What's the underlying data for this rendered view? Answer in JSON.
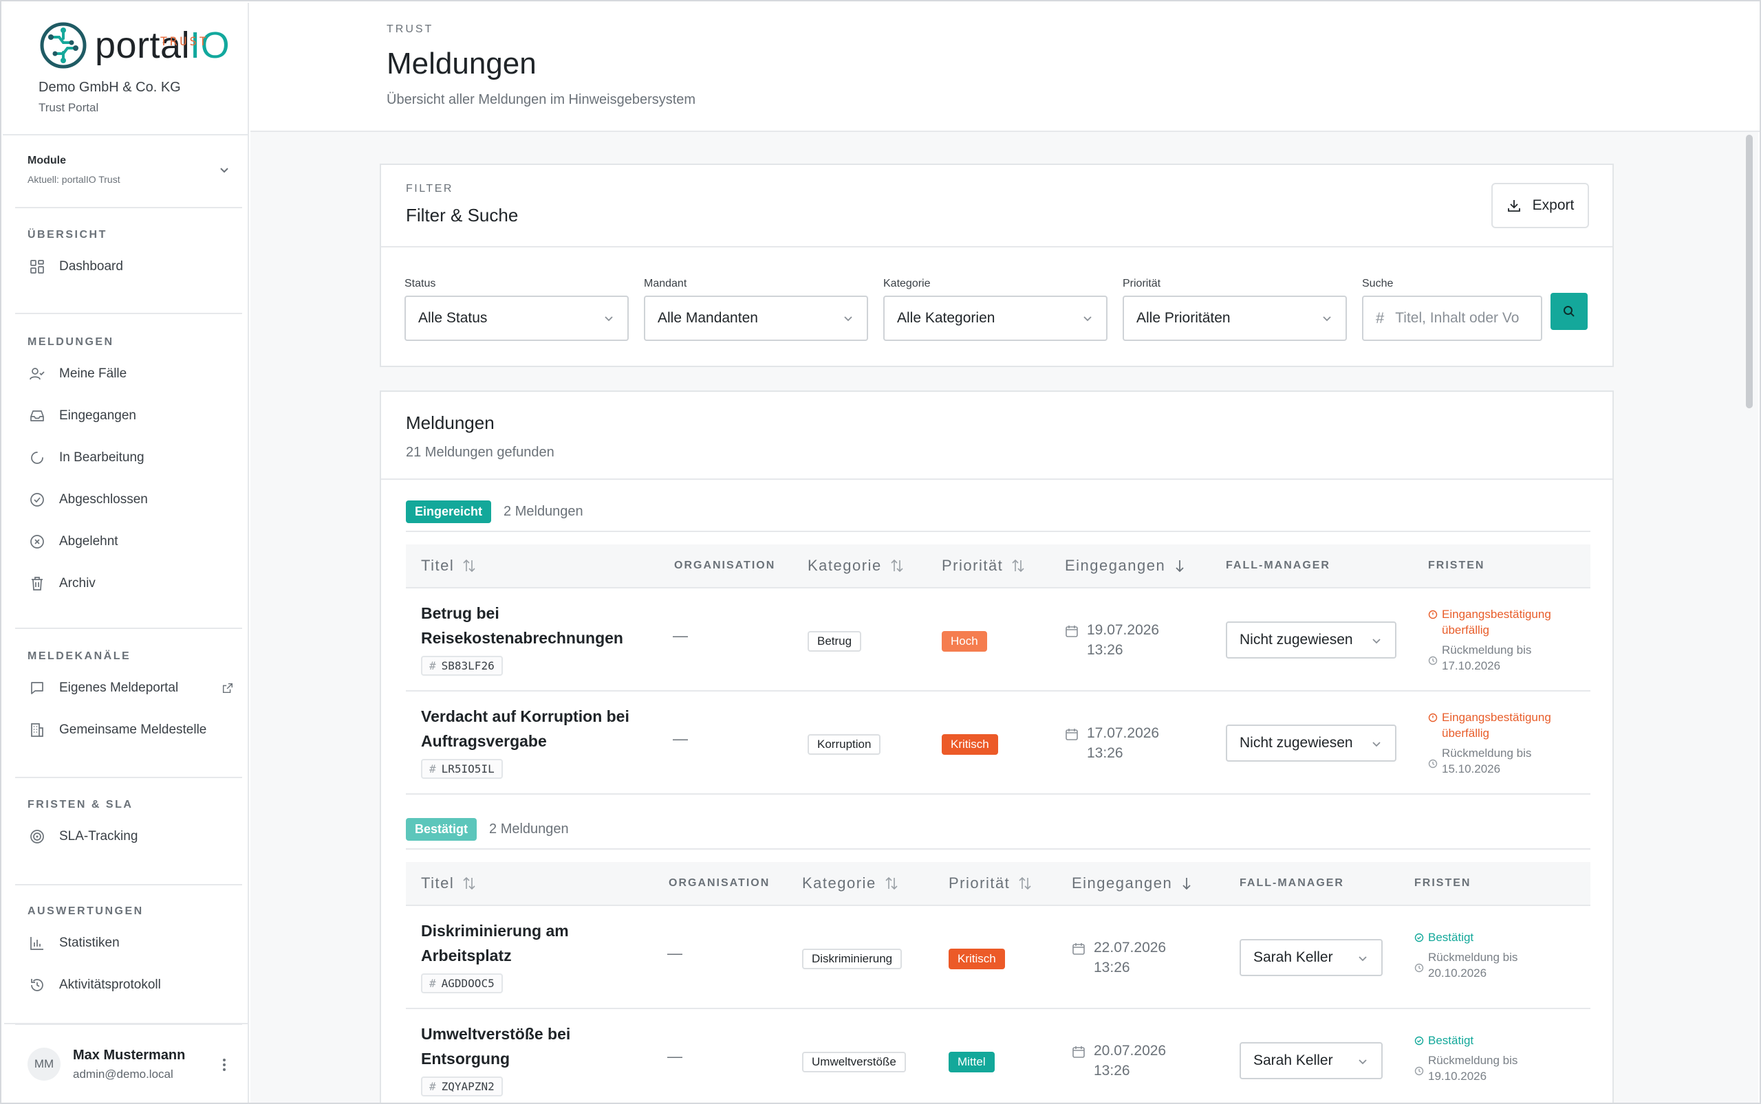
{
  "brand": {
    "logo_text": "portal",
    "logo_io": "IO",
    "logo_sub": "TRUST",
    "company": "Demo GmbH & Co. KG",
    "portal": "Trust Portal"
  },
  "module": {
    "label": "Module",
    "current": "Aktuell: portalIO Trust"
  },
  "nav": {
    "overview": {
      "heading": "ÜBERSICHT",
      "items": [
        {
          "label": "Dashboard",
          "icon": "grid-icon"
        }
      ]
    },
    "reports": {
      "heading": "MELDUNGEN",
      "items": [
        {
          "label": "Meine Fälle",
          "icon": "user-check-icon"
        },
        {
          "label": "Eingegangen",
          "icon": "inbox-icon"
        },
        {
          "label": "In Bearbeitung",
          "icon": "loader-icon"
        },
        {
          "label": "Abgeschlossen",
          "icon": "check-circle-icon"
        },
        {
          "label": "Abgelehnt",
          "icon": "x-circle-icon"
        },
        {
          "label": "Archiv",
          "icon": "trash-icon"
        }
      ]
    },
    "channels": {
      "heading": "MELDEKANÄLE",
      "items": [
        {
          "label": "Eigenes Meldeportal",
          "icon": "message-square-icon"
        },
        {
          "label": "Gemeinsame Meldestelle",
          "icon": "building-icon"
        }
      ]
    },
    "deadlines": {
      "heading": "FRISTEN & SLA",
      "items": [
        {
          "label": "SLA-Tracking",
          "icon": "target-icon"
        }
      ]
    },
    "analytics": {
      "heading": "AUSWERTUNGEN",
      "items": [
        {
          "label": "Statistiken",
          "icon": "bar-chart-icon"
        },
        {
          "label": "Aktivitätsprotokoll",
          "icon": "history-icon"
        }
      ]
    }
  },
  "user": {
    "initials": "MM",
    "name": "Max Mustermann",
    "email": "admin@demo.local"
  },
  "header": {
    "kicker": "TRUST",
    "title": "Meldungen",
    "subtitle": "Übersicht aller Meldungen im Hinweisgebersystem"
  },
  "filter": {
    "kicker": "FILTER",
    "title": "Filter & Suche",
    "export_label": "Export",
    "fields": [
      {
        "label": "Status",
        "value": "Alle Status"
      },
      {
        "label": "Mandant",
        "value": "Alle Mandanten"
      },
      {
        "label": "Kategorie",
        "value": "Alle Kategorien"
      },
      {
        "label": "Priorität",
        "value": "Alle Prioritäten"
      }
    ],
    "search": {
      "label": "Suche",
      "placeholder": "Titel, Inhalt oder Vo"
    }
  },
  "results": {
    "title": "Meldungen",
    "count_text": "21 Meldungen gefunden",
    "columns": {
      "title": "Titel",
      "organisation": "ORGANISATION",
      "category": "Kategorie",
      "priority": "Priorität",
      "received": "Eingegangen",
      "manager": "FALL-MANAGER",
      "deadlines": "FRISTEN"
    },
    "groups": [
      {
        "status": "Eingereicht",
        "status_color": "#13a89a",
        "count": "2 Meldungen",
        "rows": [
          {
            "title": [
              "Betrug bei",
              "Reisekostenabrechnungen"
            ],
            "id": "SB83LF26",
            "organisation": "—",
            "category": "Betrug",
            "priority": "Hoch",
            "priority_color": "#f57d4f",
            "date": "19.07.2026",
            "time": "13:26",
            "manager": "Nicht zugewiesen",
            "deadline_main": [
              "Eingangsbestätigung",
              "überfällig"
            ],
            "deadline_state": "warn",
            "deadline_sub": [
              "Rückmeldung bis",
              "17.10.2026"
            ]
          },
          {
            "title": [
              "Verdacht auf Korruption bei",
              "Auftragsvergabe"
            ],
            "id": "LR5IO5IL",
            "organisation": "—",
            "category": "Korruption",
            "priority": "Kritisch",
            "priority_color": "#ec5a28",
            "date": "17.07.2026",
            "time": "13:26",
            "manager": "Nicht zugewiesen",
            "deadline_main": [
              "Eingangsbestätigung",
              "überfällig"
            ],
            "deadline_state": "warn",
            "deadline_sub": [
              "Rückmeldung bis",
              "15.10.2026"
            ]
          }
        ]
      },
      {
        "status": "Bestätigt",
        "status_color": "#5cc6bb",
        "count": "2 Meldungen",
        "rows": [
          {
            "title": [
              "Diskriminierung am",
              "Arbeitsplatz"
            ],
            "id": "AGDDOOC5",
            "organisation": "—",
            "category": "Diskriminierung",
            "priority": "Kritisch",
            "priority_color": "#ec5a28",
            "date": "22.07.2026",
            "time": "13:26",
            "manager": "Sarah Keller",
            "deadline_main": [
              "Bestätigt"
            ],
            "deadline_state": "ok",
            "deadline_sub": [
              "Rückmeldung bis",
              "20.10.2026"
            ]
          },
          {
            "title": [
              "Umweltverstöße bei",
              "Entsorgung"
            ],
            "id": "ZQYAPZN2",
            "organisation": "—",
            "category": "Umweltverstöße",
            "priority": "Mittel",
            "priority_color": "#13a89a",
            "date": "20.07.2026",
            "time": "13:26",
            "manager": "Sarah Keller",
            "deadline_main": [
              "Bestätigt"
            ],
            "deadline_state": "ok",
            "deadline_sub": [
              "Rückmeldung bis",
              "19.10.2026"
            ]
          }
        ]
      }
    ]
  }
}
